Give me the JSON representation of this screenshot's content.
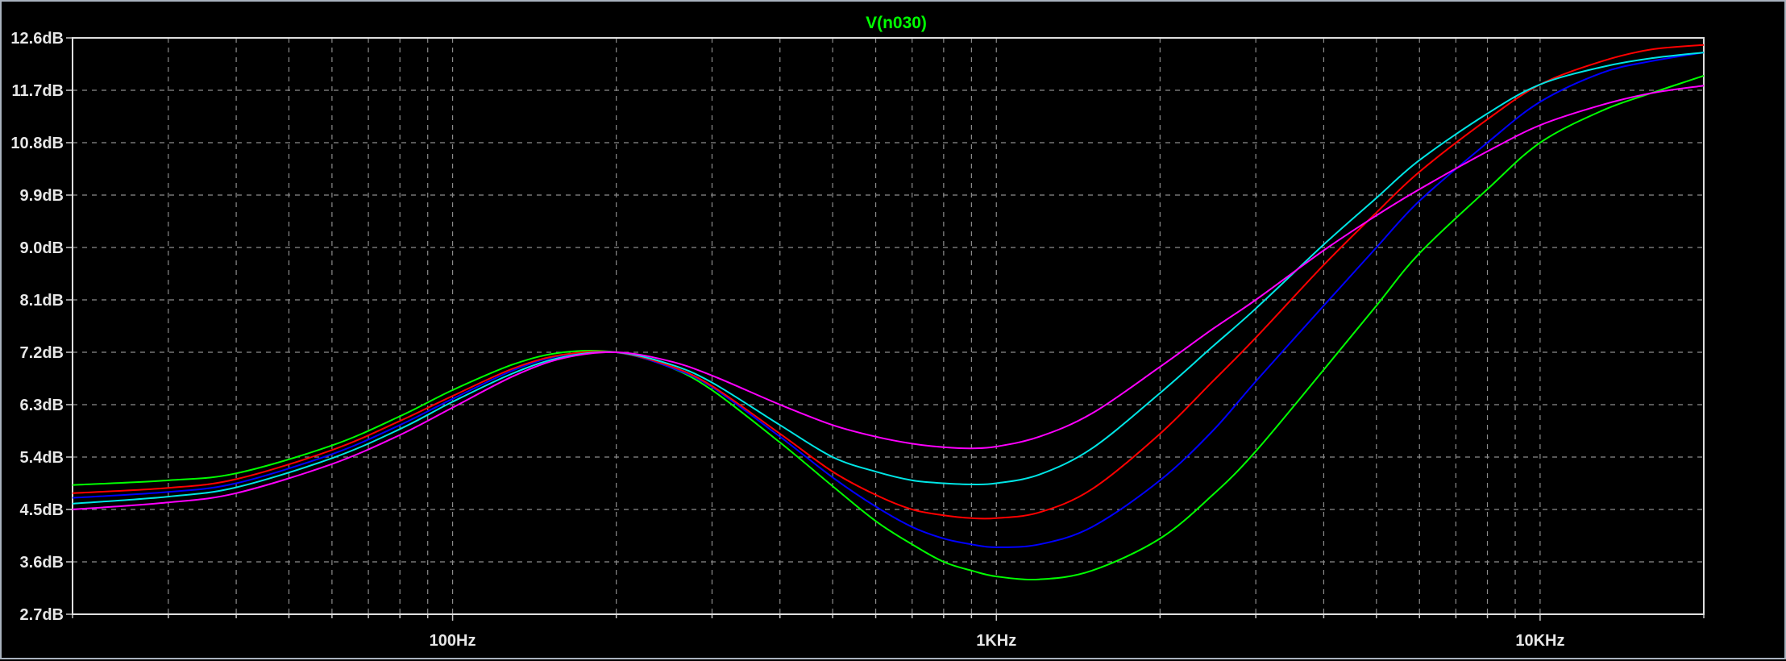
{
  "chart_data": {
    "type": "line",
    "title": "V(n030)",
    "xlabel": "",
    "ylabel": "",
    "x_scale": "log",
    "xlim": [
      20,
      20000
    ],
    "ylim": [
      2.7,
      12.6
    ],
    "x_ticks": [
      {
        "value": 100,
        "label": "100Hz"
      },
      {
        "value": 1000,
        "label": "1KHz"
      },
      {
        "value": 10000,
        "label": "10KHz"
      }
    ],
    "y_ticks": [
      {
        "value": 12.6,
        "label": "12.6dB"
      },
      {
        "value": 11.7,
        "label": "11.7dB"
      },
      {
        "value": 10.8,
        "label": "10.8dB"
      },
      {
        "value": 9.9,
        "label": "9.9dB"
      },
      {
        "value": 9.0,
        "label": "9.0dB"
      },
      {
        "value": 8.1,
        "label": "8.1dB"
      },
      {
        "value": 7.2,
        "label": "7.2dB"
      },
      {
        "value": 6.3,
        "label": "6.3dB"
      },
      {
        "value": 5.4,
        "label": "5.4dB"
      },
      {
        "value": 4.5,
        "label": "4.5dB"
      },
      {
        "value": 3.6,
        "label": "3.6dB"
      },
      {
        "value": 2.7,
        "label": "2.7dB"
      }
    ],
    "grid": true,
    "x": [
      20,
      30,
      40,
      60,
      80,
      100,
      130,
      160,
      200,
      250,
      300,
      400,
      500,
      600,
      700,
      800,
      900,
      1000,
      1200,
      1500,
      2000,
      2500,
      3000,
      4000,
      5000,
      6000,
      8000,
      10000,
      13000,
      16000,
      20000
    ],
    "series": [
      {
        "color": "#00ff00",
        "values": [
          4.92,
          5.0,
          5.12,
          5.6,
          6.1,
          6.55,
          7.0,
          7.2,
          7.2,
          6.95,
          6.55,
          5.65,
          4.9,
          4.3,
          3.9,
          3.6,
          3.45,
          3.35,
          3.3,
          3.45,
          4.0,
          4.75,
          5.5,
          6.9,
          8.0,
          8.9,
          10.0,
          10.8,
          11.35,
          11.65,
          11.95
        ]
      },
      {
        "color": "#0000ff",
        "values": [
          4.7,
          4.8,
          4.95,
          5.45,
          5.95,
          6.4,
          6.9,
          7.15,
          7.2,
          6.95,
          6.6,
          5.75,
          5.05,
          4.55,
          4.2,
          4.0,
          3.9,
          3.85,
          3.9,
          4.2,
          5.0,
          5.85,
          6.7,
          8.0,
          9.0,
          9.8,
          10.8,
          11.5,
          12.0,
          12.2,
          12.35
        ]
      },
      {
        "color": "#ff0000",
        "values": [
          4.78,
          4.87,
          5.02,
          5.52,
          6.02,
          6.45,
          6.93,
          7.16,
          7.2,
          6.97,
          6.62,
          5.8,
          5.15,
          4.75,
          4.5,
          4.4,
          4.35,
          4.35,
          4.45,
          4.85,
          5.8,
          6.7,
          7.45,
          8.7,
          9.6,
          10.3,
          11.2,
          11.8,
          12.2,
          12.4,
          12.48
        ]
      },
      {
        "color": "#00e5e5",
        "values": [
          4.6,
          4.72,
          4.88,
          5.38,
          5.88,
          6.35,
          6.85,
          7.12,
          7.2,
          7.0,
          6.68,
          5.95,
          5.4,
          5.15,
          5.0,
          4.95,
          4.93,
          4.95,
          5.1,
          5.55,
          6.5,
          7.3,
          7.95,
          9.05,
          9.85,
          10.5,
          11.3,
          11.8,
          12.1,
          12.25,
          12.35
        ]
      },
      {
        "color": "#ff00ff",
        "values": [
          4.5,
          4.62,
          4.78,
          5.28,
          5.78,
          6.25,
          6.8,
          7.1,
          7.2,
          7.05,
          6.8,
          6.3,
          5.95,
          5.75,
          5.63,
          5.57,
          5.55,
          5.58,
          5.75,
          6.15,
          6.95,
          7.6,
          8.1,
          8.95,
          9.55,
          10.0,
          10.65,
          11.1,
          11.45,
          11.65,
          11.78
        ]
      }
    ]
  }
}
